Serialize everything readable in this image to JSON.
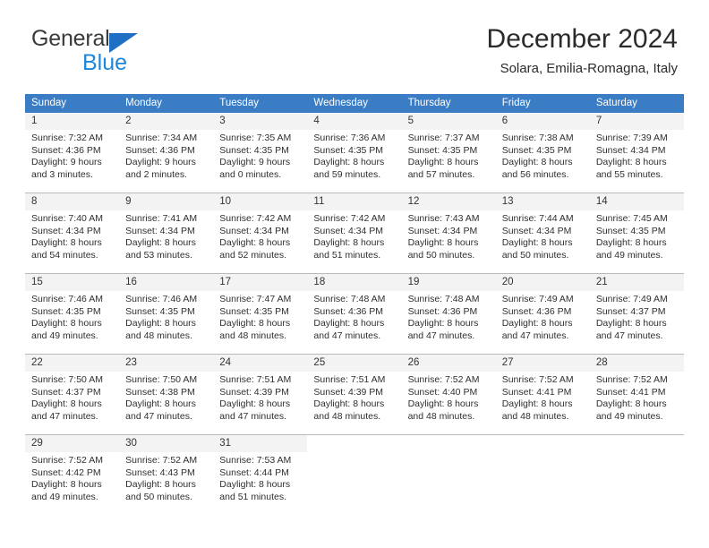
{
  "logo": {
    "word_one": "General",
    "word_two": "Blue",
    "triangle_icon": "triangle-icon",
    "brand_dark": "#3a3a3a",
    "brand_blue": "#1f86d8",
    "triangle_blue": "#1f6fc4"
  },
  "header": {
    "title": "December 2024",
    "subtitle": "Solara, Emilia-Romagna, Italy",
    "header_bg": "#3b7dc4",
    "header_text": "#ffffff",
    "daynum_bg": "#f3f3f3"
  },
  "calendar": {
    "weekday_headers": [
      "Sunday",
      "Monday",
      "Tuesday",
      "Wednesday",
      "Thursday",
      "Friday",
      "Saturday"
    ],
    "weeks": [
      [
        {
          "day": "1",
          "sunrise": "Sunrise: 7:32 AM",
          "sunset": "Sunset: 4:36 PM",
          "daylight_1": "Daylight: 9 hours",
          "daylight_2": "and 3 minutes."
        },
        {
          "day": "2",
          "sunrise": "Sunrise: 7:34 AM",
          "sunset": "Sunset: 4:36 PM",
          "daylight_1": "Daylight: 9 hours",
          "daylight_2": "and 2 minutes."
        },
        {
          "day": "3",
          "sunrise": "Sunrise: 7:35 AM",
          "sunset": "Sunset: 4:35 PM",
          "daylight_1": "Daylight: 9 hours",
          "daylight_2": "and 0 minutes."
        },
        {
          "day": "4",
          "sunrise": "Sunrise: 7:36 AM",
          "sunset": "Sunset: 4:35 PM",
          "daylight_1": "Daylight: 8 hours",
          "daylight_2": "and 59 minutes."
        },
        {
          "day": "5",
          "sunrise": "Sunrise: 7:37 AM",
          "sunset": "Sunset: 4:35 PM",
          "daylight_1": "Daylight: 8 hours",
          "daylight_2": "and 57 minutes."
        },
        {
          "day": "6",
          "sunrise": "Sunrise: 7:38 AM",
          "sunset": "Sunset: 4:35 PM",
          "daylight_1": "Daylight: 8 hours",
          "daylight_2": "and 56 minutes."
        },
        {
          "day": "7",
          "sunrise": "Sunrise: 7:39 AM",
          "sunset": "Sunset: 4:34 PM",
          "daylight_1": "Daylight: 8 hours",
          "daylight_2": "and 55 minutes."
        }
      ],
      [
        {
          "day": "8",
          "sunrise": "Sunrise: 7:40 AM",
          "sunset": "Sunset: 4:34 PM",
          "daylight_1": "Daylight: 8 hours",
          "daylight_2": "and 54 minutes."
        },
        {
          "day": "9",
          "sunrise": "Sunrise: 7:41 AM",
          "sunset": "Sunset: 4:34 PM",
          "daylight_1": "Daylight: 8 hours",
          "daylight_2": "and 53 minutes."
        },
        {
          "day": "10",
          "sunrise": "Sunrise: 7:42 AM",
          "sunset": "Sunset: 4:34 PM",
          "daylight_1": "Daylight: 8 hours",
          "daylight_2": "and 52 minutes."
        },
        {
          "day": "11",
          "sunrise": "Sunrise: 7:42 AM",
          "sunset": "Sunset: 4:34 PM",
          "daylight_1": "Daylight: 8 hours",
          "daylight_2": "and 51 minutes."
        },
        {
          "day": "12",
          "sunrise": "Sunrise: 7:43 AM",
          "sunset": "Sunset: 4:34 PM",
          "daylight_1": "Daylight: 8 hours",
          "daylight_2": "and 50 minutes."
        },
        {
          "day": "13",
          "sunrise": "Sunrise: 7:44 AM",
          "sunset": "Sunset: 4:34 PM",
          "daylight_1": "Daylight: 8 hours",
          "daylight_2": "and 50 minutes."
        },
        {
          "day": "14",
          "sunrise": "Sunrise: 7:45 AM",
          "sunset": "Sunset: 4:35 PM",
          "daylight_1": "Daylight: 8 hours",
          "daylight_2": "and 49 minutes."
        }
      ],
      [
        {
          "day": "15",
          "sunrise": "Sunrise: 7:46 AM",
          "sunset": "Sunset: 4:35 PM",
          "daylight_1": "Daylight: 8 hours",
          "daylight_2": "and 49 minutes."
        },
        {
          "day": "16",
          "sunrise": "Sunrise: 7:46 AM",
          "sunset": "Sunset: 4:35 PM",
          "daylight_1": "Daylight: 8 hours",
          "daylight_2": "and 48 minutes."
        },
        {
          "day": "17",
          "sunrise": "Sunrise: 7:47 AM",
          "sunset": "Sunset: 4:35 PM",
          "daylight_1": "Daylight: 8 hours",
          "daylight_2": "and 48 minutes."
        },
        {
          "day": "18",
          "sunrise": "Sunrise: 7:48 AM",
          "sunset": "Sunset: 4:36 PM",
          "daylight_1": "Daylight: 8 hours",
          "daylight_2": "and 47 minutes."
        },
        {
          "day": "19",
          "sunrise": "Sunrise: 7:48 AM",
          "sunset": "Sunset: 4:36 PM",
          "daylight_1": "Daylight: 8 hours",
          "daylight_2": "and 47 minutes."
        },
        {
          "day": "20",
          "sunrise": "Sunrise: 7:49 AM",
          "sunset": "Sunset: 4:36 PM",
          "daylight_1": "Daylight: 8 hours",
          "daylight_2": "and 47 minutes."
        },
        {
          "day": "21",
          "sunrise": "Sunrise: 7:49 AM",
          "sunset": "Sunset: 4:37 PM",
          "daylight_1": "Daylight: 8 hours",
          "daylight_2": "and 47 minutes."
        }
      ],
      [
        {
          "day": "22",
          "sunrise": "Sunrise: 7:50 AM",
          "sunset": "Sunset: 4:37 PM",
          "daylight_1": "Daylight: 8 hours",
          "daylight_2": "and 47 minutes."
        },
        {
          "day": "23",
          "sunrise": "Sunrise: 7:50 AM",
          "sunset": "Sunset: 4:38 PM",
          "daylight_1": "Daylight: 8 hours",
          "daylight_2": "and 47 minutes."
        },
        {
          "day": "24",
          "sunrise": "Sunrise: 7:51 AM",
          "sunset": "Sunset: 4:39 PM",
          "daylight_1": "Daylight: 8 hours",
          "daylight_2": "and 47 minutes."
        },
        {
          "day": "25",
          "sunrise": "Sunrise: 7:51 AM",
          "sunset": "Sunset: 4:39 PM",
          "daylight_1": "Daylight: 8 hours",
          "daylight_2": "and 48 minutes."
        },
        {
          "day": "26",
          "sunrise": "Sunrise: 7:52 AM",
          "sunset": "Sunset: 4:40 PM",
          "daylight_1": "Daylight: 8 hours",
          "daylight_2": "and 48 minutes."
        },
        {
          "day": "27",
          "sunrise": "Sunrise: 7:52 AM",
          "sunset": "Sunset: 4:41 PM",
          "daylight_1": "Daylight: 8 hours",
          "daylight_2": "and 48 minutes."
        },
        {
          "day": "28",
          "sunrise": "Sunrise: 7:52 AM",
          "sunset": "Sunset: 4:41 PM",
          "daylight_1": "Daylight: 8 hours",
          "daylight_2": "and 49 minutes."
        }
      ],
      [
        {
          "day": "29",
          "sunrise": "Sunrise: 7:52 AM",
          "sunset": "Sunset: 4:42 PM",
          "daylight_1": "Daylight: 8 hours",
          "daylight_2": "and 49 minutes."
        },
        {
          "day": "30",
          "sunrise": "Sunrise: 7:52 AM",
          "sunset": "Sunset: 4:43 PM",
          "daylight_1": "Daylight: 8 hours",
          "daylight_2": "and 50 minutes."
        },
        {
          "day": "31",
          "sunrise": "Sunrise: 7:53 AM",
          "sunset": "Sunset: 4:44 PM",
          "daylight_1": "Daylight: 8 hours",
          "daylight_2": "and 51 minutes."
        },
        {
          "day": "",
          "sunrise": "",
          "sunset": "",
          "daylight_1": "",
          "daylight_2": ""
        },
        {
          "day": "",
          "sunrise": "",
          "sunset": "",
          "daylight_1": "",
          "daylight_2": ""
        },
        {
          "day": "",
          "sunrise": "",
          "sunset": "",
          "daylight_1": "",
          "daylight_2": ""
        },
        {
          "day": "",
          "sunrise": "",
          "sunset": "",
          "daylight_1": "",
          "daylight_2": ""
        }
      ]
    ]
  }
}
